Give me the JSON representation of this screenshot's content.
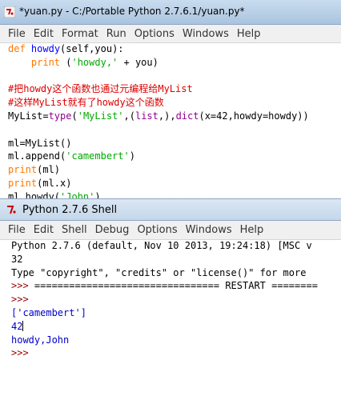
{
  "editor": {
    "title": "*yuan.py - C:/Portable Python 2.7.6.1/yuan.py*",
    "menu": [
      "File",
      "Edit",
      "Format",
      "Run",
      "Options",
      "Windows",
      "Help"
    ],
    "code": {
      "def": "def",
      "l1_name": "howdy",
      "l1_rest": "(self,you):",
      "print": "print",
      "l2_open": " (",
      "l2_str": "'howdy,'",
      "l2_rest": " + you)",
      "comment1": "#把howdy这个函数也通过元编程给MyList",
      "comment2": "#这样MyList就有了howdy这个函数",
      "l5_a": "MyList=",
      "type": "type",
      "l5_b": "(",
      "l5_str": "'MyList'",
      "l5_c": ",(",
      "list": "list",
      "l5_d": ",),",
      "dict": "dict",
      "l5_e": "(x=42,howdy=howdy))",
      "l7": "ml=MyList()",
      "l8_a": "ml.append(",
      "l8_str": "'camembert'",
      "l8_b": ")",
      "l9_rest": "(ml)",
      "l10_rest": "(ml.x)",
      "l11_a": "ml.howdy(",
      "l11_str": "'John'",
      "l11_b": ")"
    }
  },
  "shell": {
    "title": "Python 2.7.6 Shell",
    "menu": [
      "File",
      "Edit",
      "Shell",
      "Debug",
      "Options",
      "Windows",
      "Help"
    ],
    "banner1": "Python 2.7.6 (default, Nov 10 2013, 19:24:18) [MSC v",
    "banner2": "32",
    "banner3": "Type \"copyright\", \"credits\" or \"license()\" for more",
    "prompt": ">>>",
    "restart": " ================================ RESTART ========",
    "out1": "['camembert']",
    "out2": "42",
    "out3": "howdy,John"
  },
  "colors": {
    "keyword": "#ff7700",
    "builtin": "#900090",
    "string": "#00aa00",
    "definition": "#0000ff",
    "comment": "#dd0000",
    "prompt": "#a00000",
    "stdout": "#0000cc"
  }
}
